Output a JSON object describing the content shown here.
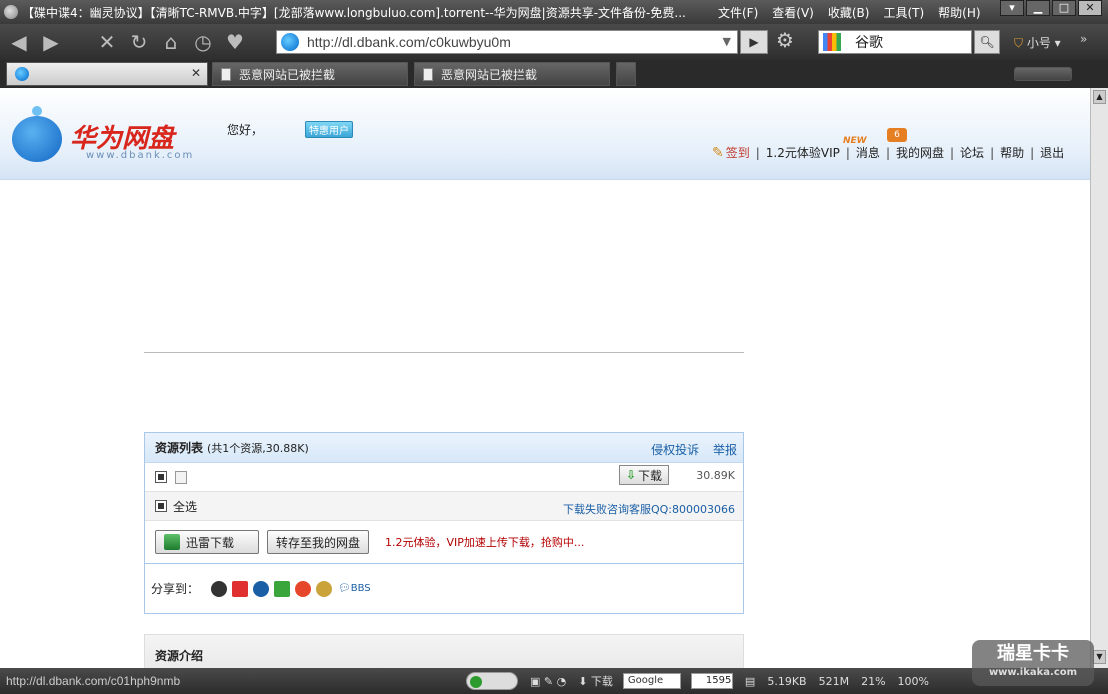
{
  "window": {
    "title": "【碟中谍4：幽灵协议】【清晰TC-RMVB.中字】[龙部落www.longbuluo.com].torrent--华为网盘|资源共享-文件备份-免费...",
    "menu": [
      "文件(F)",
      "查看(V)",
      "收藏(B)",
      "工具(T)",
      "帮助(H)"
    ]
  },
  "toolbar": {
    "url": "http://dl.dbank.com/c0kuwbyu0m",
    "search_engine": "谷歌",
    "user_label": "小号"
  },
  "tabs": [
    {
      "label": ""
    },
    {
      "label": "恶意网站已被拦截"
    },
    {
      "label": "恶意网站已被拦截"
    }
  ],
  "header": {
    "brand_name": "华为网盘",
    "brand_sub": "www.dbank.com",
    "greeting": "您好，",
    "user_badge": "特惠用户",
    "nav": {
      "checkin": "签到",
      "vip": "1.2元体验VIP",
      "new_badge": "NEW",
      "messages": "消息",
      "message_count": "6",
      "my_disk": "我的网盘",
      "forum": "论坛",
      "help": "帮助",
      "logout": "退出"
    }
  },
  "resources": {
    "title": "资源列表",
    "count_text": "(共1个资源,30.88K)",
    "report_infringement": "侵权投诉",
    "report": "举报",
    "file": {
      "name": "",
      "download_label": "下载",
      "size": "30.89K"
    },
    "select_all": "全选",
    "help_link": "下载失败咨询客服QQ:800003066",
    "thunder_button": "迅雷下载",
    "transfer_button": "转存至我的网盘",
    "promo": "1.2元体验，VIP加速上传下载，抢购中...",
    "share_label": "分享到：",
    "bbs_label": "BBS"
  },
  "intro": {
    "title": "资源介绍"
  },
  "statusbar": {
    "url": "http://dl.dbank.com/c01hph9nmb",
    "download_label": "下载",
    "google_label": "Google",
    "count": "1595",
    "speed": "5.19KB",
    "memory": "521M",
    "cpu": "21%",
    "zoom": "100%"
  },
  "watermark": {
    "text": "瑞星卡卡",
    "sub": "www.ikaka.com"
  }
}
